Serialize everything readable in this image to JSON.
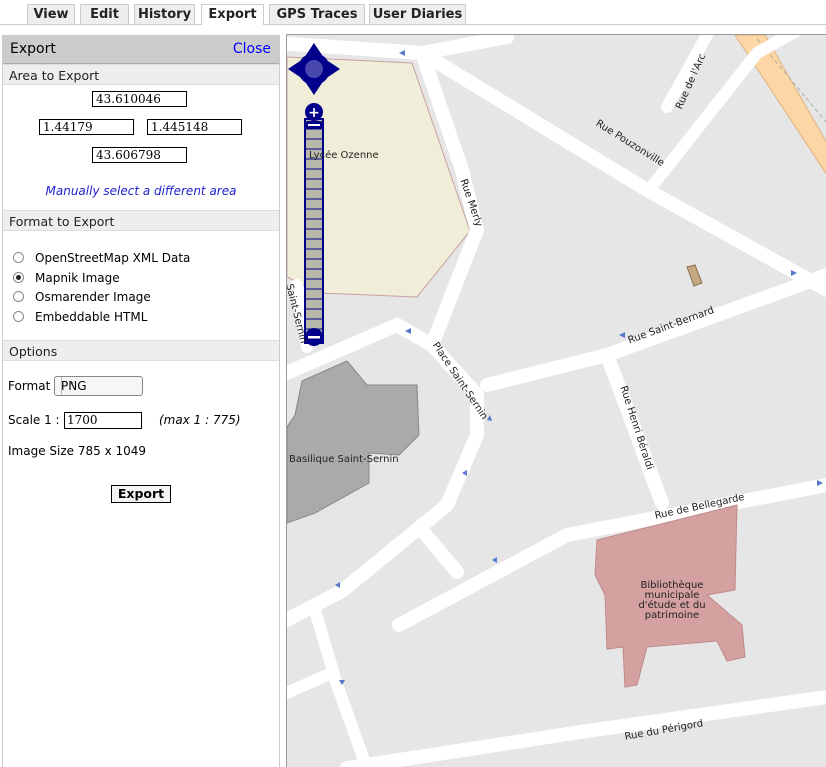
{
  "tabs": [
    {
      "label": "View",
      "active": false
    },
    {
      "label": "Edit",
      "active": false
    },
    {
      "label": "History",
      "active": false
    },
    {
      "label": "Export",
      "active": true
    },
    {
      "label": "GPS Traces",
      "active": false
    },
    {
      "label": "User Diaries",
      "active": false
    }
  ],
  "sidebar": {
    "title": "Export",
    "close_label": "Close",
    "area": {
      "heading": "Area to Export",
      "north": "43.610046",
      "west": "1.44179",
      "east": "1.445148",
      "south": "43.606798",
      "manual_link": "Manually select a different area"
    },
    "format": {
      "heading": "Format to Export",
      "options": [
        {
          "label": "OpenStreetMap XML Data",
          "checked": false
        },
        {
          "label": "Mapnik Image",
          "checked": true
        },
        {
          "label": "Osmarender Image",
          "checked": false
        },
        {
          "label": "Embeddable HTML",
          "checked": false
        }
      ]
    },
    "options": {
      "heading": "Options",
      "format_label": "Format",
      "format_value": "PNG",
      "scale_label": "Scale 1 :",
      "scale_value": "1700",
      "scale_max": "(max 1 : 775)",
      "image_size": "Image Size 785 x 1049",
      "export_button": "Export"
    }
  },
  "map": {
    "labels": {
      "lycee": "Lycée Ozenne",
      "rue_merly": "Rue Merly",
      "rue_arc": "Rue de l'Arc",
      "rue_pouzonville": "Rue Pouzonville",
      "rue_saint_bernard": "Rue Saint-Bernard",
      "place_saint_sernin": "Place Saint-Sernin",
      "saint_sernin_edge": "Saint-Sernin",
      "basilique": "Basilique Saint-Sernin",
      "rue_henri_beraldi": "Rue Henri Béraldi",
      "rue_bellegarde": "Rue de Bellegarde",
      "bibliotheque": "Bibliothèque municipale d'étude et du patrimoine",
      "rue_perigord": "Rue du Périgord"
    },
    "colors": {
      "background": "#e6e6e6",
      "road": "#ffffff",
      "school": "#f0eed8",
      "church": "#aaaaaa",
      "library": "#d4a0a0",
      "primary_road": "#fcd6a4",
      "nav_control": "#00008b"
    }
  }
}
